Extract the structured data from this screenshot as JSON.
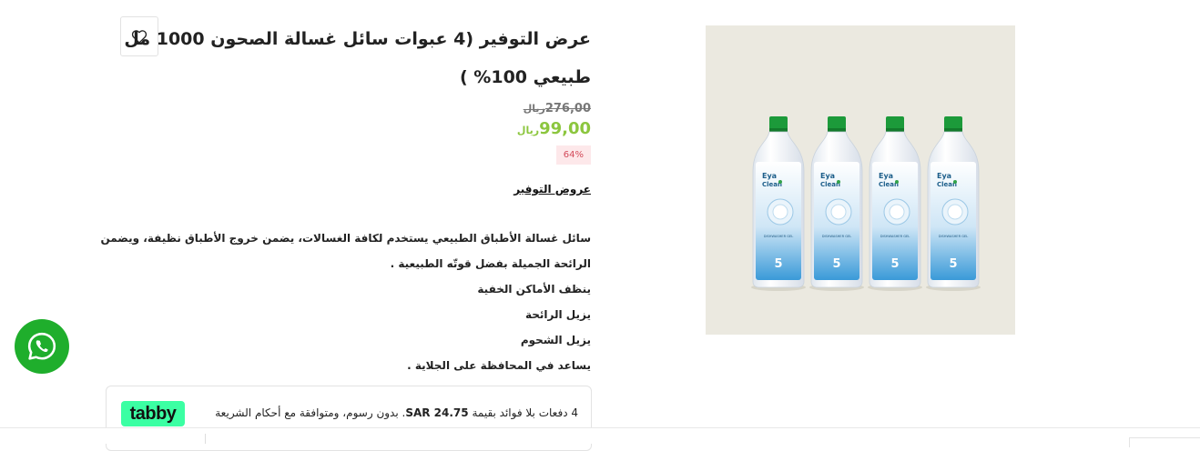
{
  "product": {
    "title": "عرض التوفير (4 عبوات سائل غسالة الصحون 1000 مل طبيعي 100% )",
    "old_price": "276,00",
    "old_currency": "ريال",
    "new_price": "99,00",
    "new_currency": "ريال",
    "discount_badge": "64%",
    "category_link": "عروض التوفير",
    "image_alt": "Eya Clean dishwasher gel bottles",
    "bottle_brand_line1": "Eya",
    "bottle_brand_line2": "Clean",
    "bottle_label": "DISHWASHER GEL",
    "bottle_number": "5"
  },
  "description": {
    "lines": [
      "سائل غسالة الأطباق الطبيعي يستخدم لكافة الغسالات، يضمن خروج الأطباق نظيفة، ويضمن الرائحة الجميلة بفضل قوتّه الطبيعية .",
      "ينظف الأماكن الخفية",
      "يزيل الرائحة",
      "يزيل الشحوم",
      "يساعد في المحافظة على الجلاية ."
    ]
  },
  "tabby": {
    "logo": "tabby",
    "text_prefix": "4 دفعات بلا فوائد بقيمة ",
    "amount": "SAR 24.75",
    "text_suffix": ". بدون رسوم، ومتوافقة مع أحكام الشريعة الإسلامية"
  },
  "icons": {
    "wishlist": "heart-icon",
    "whatsapp": "whatsapp-icon"
  },
  "colors": {
    "new_price": "#8cc63e",
    "badge_bg": "#fde8ea",
    "badge_text": "#d34a5a",
    "whatsapp": "#1fae2c",
    "tabby": "#3bffa3",
    "image_bg": "#ebe9e0"
  }
}
